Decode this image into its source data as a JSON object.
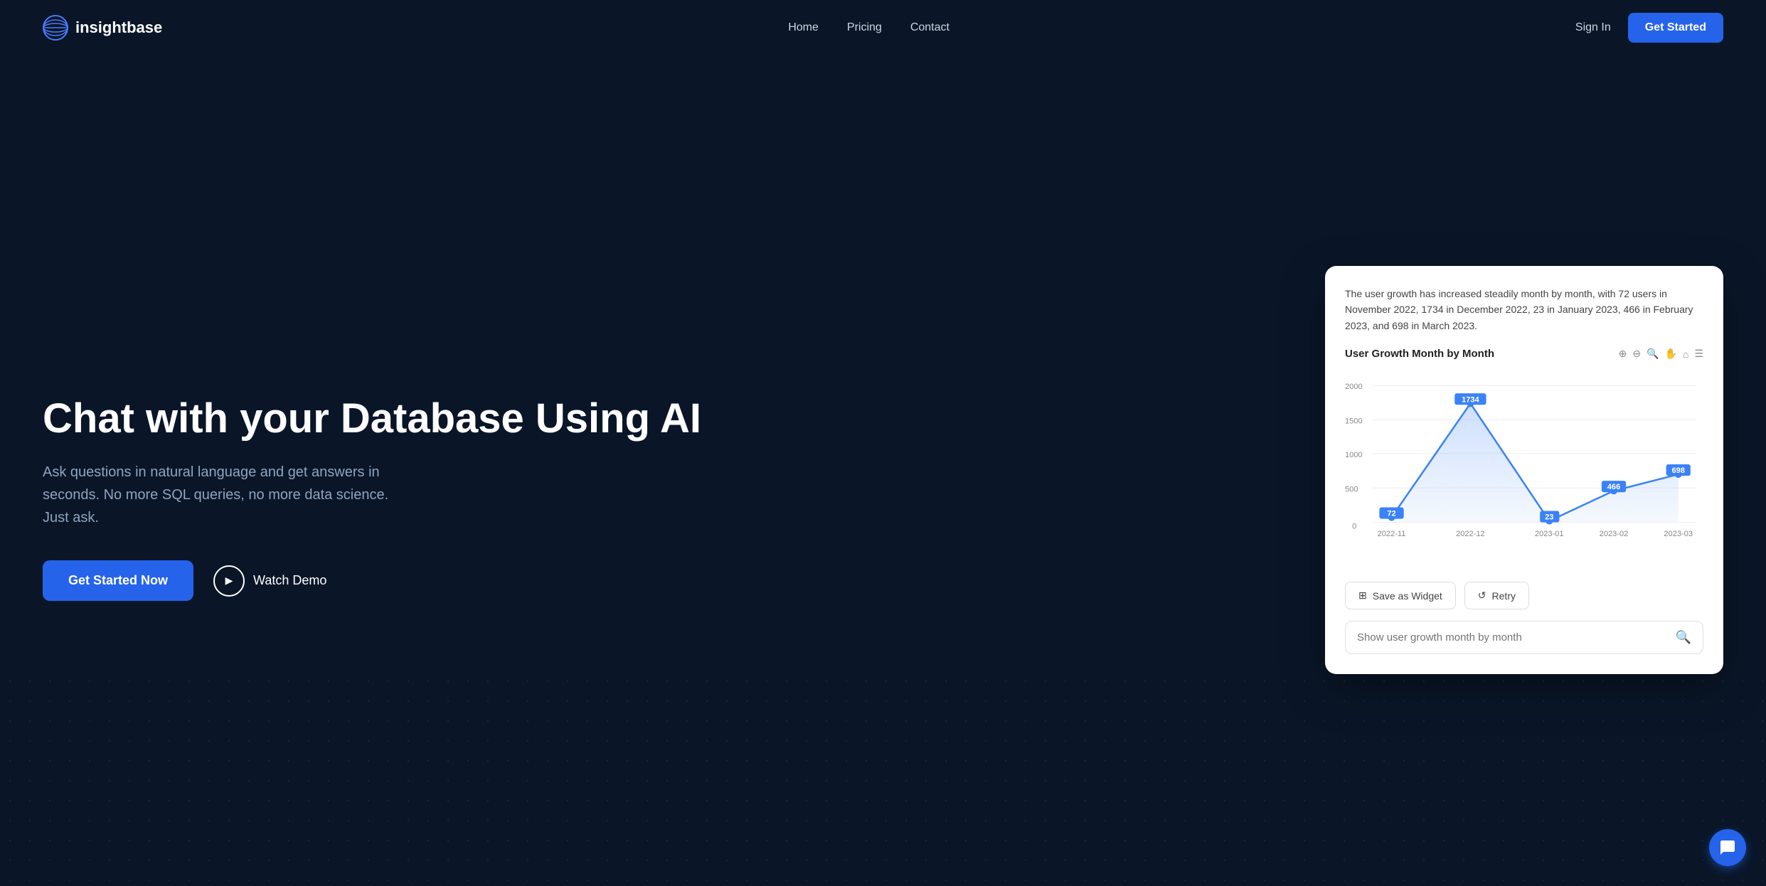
{
  "nav": {
    "logo_text": "insightbase",
    "links": [
      "Home",
      "Pricing",
      "Contact"
    ],
    "sign_in": "Sign In",
    "get_started": "Get Started"
  },
  "hero": {
    "title": "Chat with your Database Using AI",
    "subtitle": "Ask questions in natural language and get answers in seconds. No more SQL queries, no more data science. Just ask.",
    "cta_label": "Get Started Now",
    "watch_demo_label": "Watch Demo"
  },
  "chart_card": {
    "description": "The user growth has increased steadily month by month, with 72 users in November 2022, 1734 in December 2022, 23 in January 2023, 466 in February 2023, and 698 in March 2023.",
    "chart_title": "User Growth Month by Month",
    "data": [
      {
        "label": "2022-11",
        "value": 72
      },
      {
        "label": "2022-12",
        "value": 1734
      },
      {
        "label": "2023-01",
        "value": 23
      },
      {
        "label": "2023-02",
        "value": 466
      },
      {
        "label": "2023-03",
        "value": 698
      }
    ],
    "save_widget_label": "Save as Widget",
    "retry_label": "Retry",
    "search_placeholder": "Show user growth month by month"
  },
  "chat_bubble": {
    "icon": "chat-icon"
  },
  "colors": {
    "primary": "#2563eb",
    "background": "#0a1628",
    "card_bg": "#ffffff"
  }
}
